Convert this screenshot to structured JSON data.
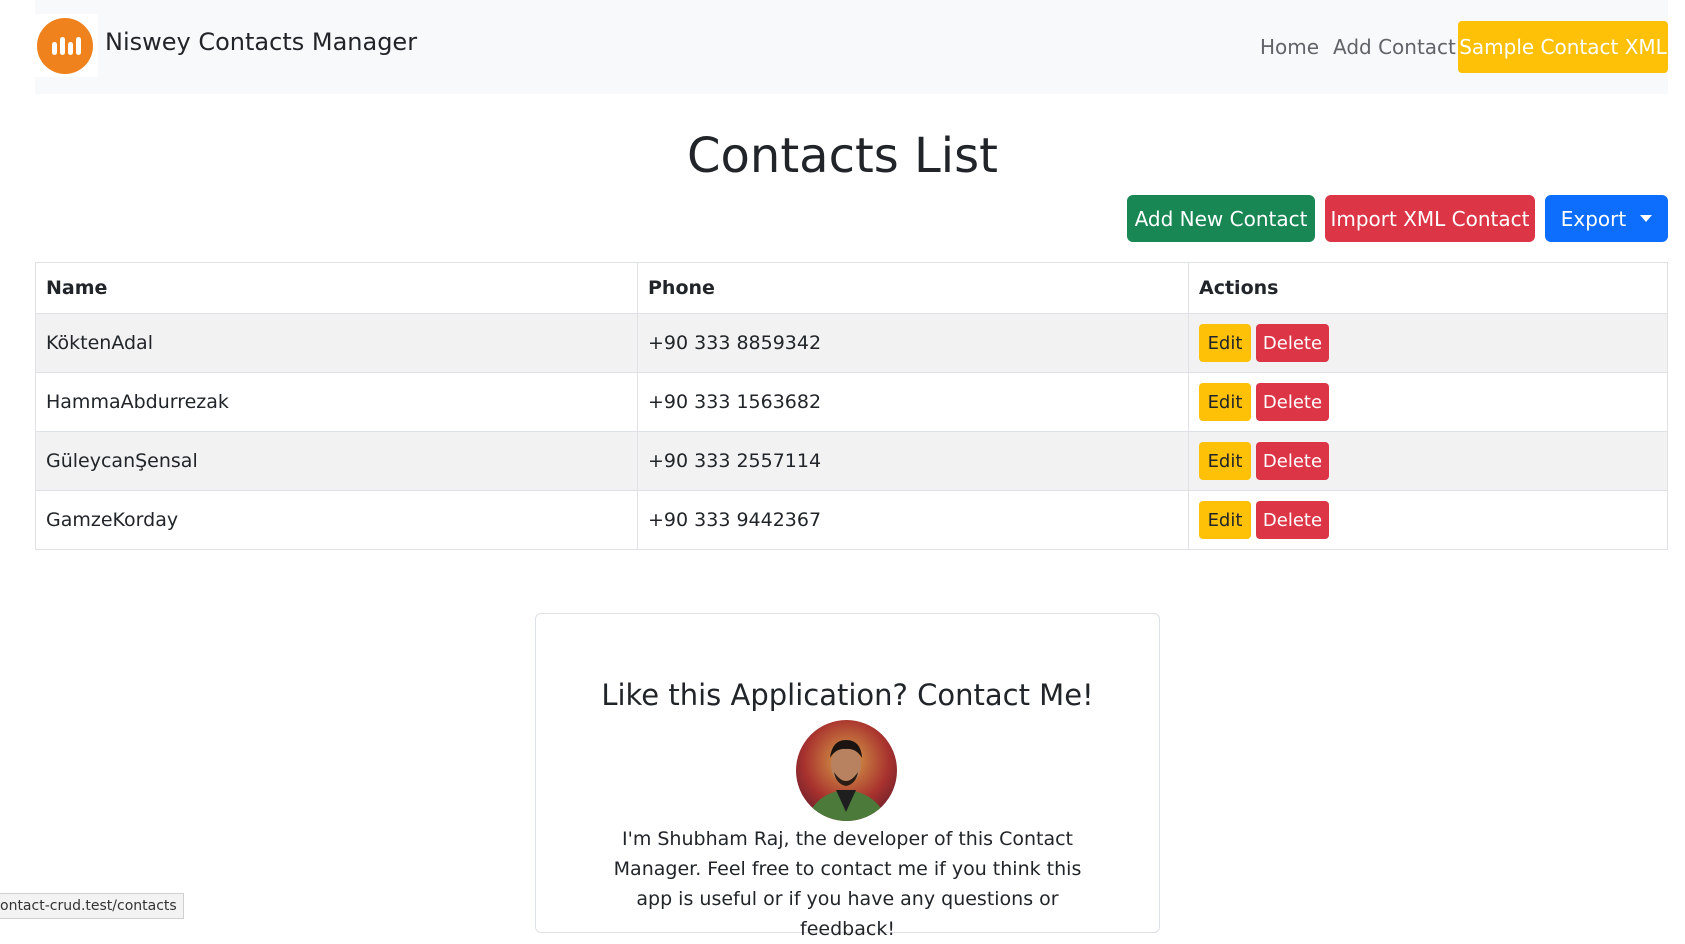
{
  "navbar": {
    "brand_name": "Niswey Contacts Manager",
    "home_label": "Home",
    "add_contact_label": "Add Contact",
    "sample_xml_label": "Sample Contact XML"
  },
  "page": {
    "title": "Contacts List",
    "add_new_label": "Add New Contact",
    "import_label": "Import XML Contact",
    "export_label": "Export"
  },
  "table": {
    "headers": {
      "name": "Name",
      "phone": "Phone",
      "actions": "Actions"
    },
    "edit_label": "Edit",
    "delete_label": "Delete",
    "rows": [
      {
        "name": "KöktenAdal",
        "phone": "+90 333 8859342"
      },
      {
        "name": "HammaAbdurrezak",
        "phone": "+90 333 1563682"
      },
      {
        "name": "GüleycanŞensal",
        "phone": "+90 333 2557114"
      },
      {
        "name": "GamzeKorday",
        "phone": "+90 333 9442367"
      }
    ]
  },
  "card": {
    "title": "Like this Application? Contact Me!",
    "text": "I'm Shubham Raj, the developer of this Contact Manager. Feel free to contact me if you think this app is useful or if you have any questions or feedback!"
  },
  "status_bar": {
    "url": "ontact-crud.test/contacts"
  },
  "colors": {
    "success": "#198754",
    "danger": "#dc3545",
    "primary": "#0d6efd",
    "warning": "#ffc107",
    "logo": "#f0821e"
  }
}
